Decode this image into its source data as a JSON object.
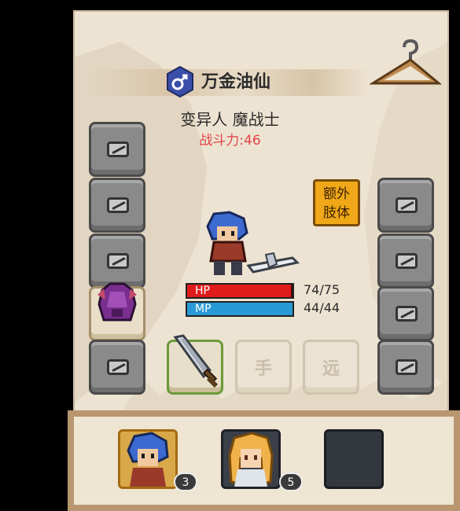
{
  "hero": {
    "name": "万金油仙",
    "class": "变异人 魔战士",
    "power": "战斗力:46"
  },
  "icons": {
    "gender": "male-icon",
    "hanger": "clothes-hanger-icon",
    "lock": "lock-icon"
  },
  "extra_limb_button": {
    "line1": "额外",
    "line2": "肢体"
  },
  "slots": {
    "hand_label": "手",
    "ranged_label": "远"
  },
  "stats": {
    "hp_label": "HP",
    "hp": "74/75",
    "hp_fraction": 0.987,
    "mp_label": "MP",
    "mp": "44/44",
    "mp_fraction": 1.0
  },
  "party": [
    {
      "badge": "3"
    },
    {
      "badge": "5"
    }
  ],
  "colors": {
    "hp": "#e01b1b",
    "mp": "#2a9ad6",
    "accent": "#f0a818",
    "panel": "#ede3d2"
  }
}
